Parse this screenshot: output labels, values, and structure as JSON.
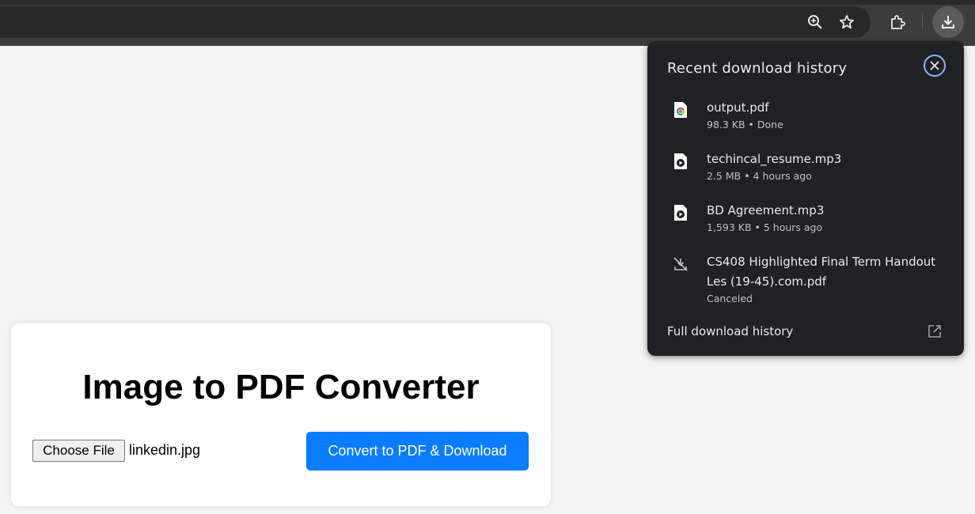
{
  "toolbar": {
    "icons": [
      "zoom-icon",
      "bookmark-star-icon",
      "extensions-puzzle-icon",
      "download-icon"
    ]
  },
  "downloads_bubble": {
    "title": "Recent download history",
    "items": [
      {
        "name": "output.pdf",
        "meta": "98.3 KB • Done",
        "icon": "chrome-file-icon"
      },
      {
        "name": "techincal_resume.mp3",
        "meta": "2.5 MB • 4 hours ago",
        "icon": "media-file-icon"
      },
      {
        "name": "BD Agreement.mp3",
        "meta": "1,593 KB • 5 hours ago",
        "icon": "media-file-icon"
      },
      {
        "name": "CS408 Highlighted Final Term Handout  Les (19-45).com.pdf",
        "meta": "Canceled",
        "icon": "download-canceled-icon"
      }
    ],
    "full_history_label": "Full download history"
  },
  "converter": {
    "title": "Image to PDF Converter",
    "choose_file_label": "Choose File",
    "selected_file": "linkedin.jpg",
    "convert_label": "Convert to PDF & Download"
  },
  "colors": {
    "accent_blue": "#0a7cff",
    "bubble_bg": "#202124",
    "close_ring": "#8ab4f8"
  }
}
